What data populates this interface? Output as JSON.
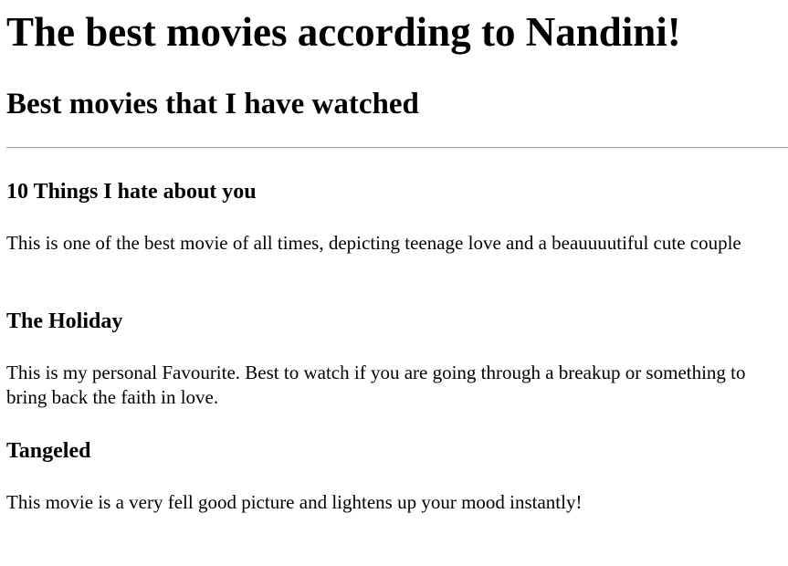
{
  "page": {
    "title": "The best movies according to Nandini!",
    "subtitle": "Best movies that I have watched"
  },
  "movies": [
    {
      "title": "10 Things I hate about you",
      "description": "This is one of the best movie of all times, depicting teenage love and a beauuuutiful cute couple"
    },
    {
      "title": "The Holiday",
      "description": "This is my personal Favourite. Best to watch if you are going through a breakup or something to bring back the faith in love."
    },
    {
      "title": "Tangeled",
      "description": "This movie is a very fell good picture and lightens up your mood instantly!"
    }
  ]
}
